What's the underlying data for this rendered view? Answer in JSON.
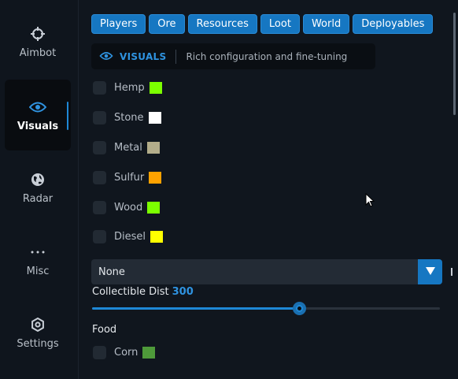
{
  "nav": {
    "items": [
      {
        "label": "Aimbot",
        "icon": "crosshair-icon"
      },
      {
        "label": "Visuals",
        "icon": "eye-icon",
        "active": true
      },
      {
        "label": "Radar",
        "icon": "globe-icon"
      },
      {
        "label": "Misc",
        "icon": "more-dots-icon"
      },
      {
        "label": "Settings",
        "icon": "gear-icon"
      }
    ]
  },
  "tabs": [
    "Players",
    "Ore",
    "Resources",
    "Loot",
    "World",
    "Deployables"
  ],
  "header": {
    "title": "VISUALS",
    "description": "Rich configuration and fine-tuning"
  },
  "resources": [
    {
      "label": "Hemp",
      "color": "#7cff00",
      "checked": false
    },
    {
      "label": "Stone",
      "color": "#ffffff",
      "checked": false
    },
    {
      "label": "Metal",
      "color": "#b3ad8a",
      "checked": false
    },
    {
      "label": "Sulfur",
      "color": "#ffa200",
      "checked": false
    },
    {
      "label": "Wood",
      "color": "#7cff00",
      "checked": false
    },
    {
      "label": "Diesel",
      "color": "#ffff00",
      "checked": false
    }
  ],
  "dropdown": {
    "selected": "None"
  },
  "slider": {
    "label": "Collectible Dist",
    "value": "300",
    "fraction": 0.595
  },
  "food": {
    "title": "Food",
    "items": [
      {
        "label": "Corn",
        "color": "#4e9a3a",
        "checked": false
      }
    ]
  }
}
